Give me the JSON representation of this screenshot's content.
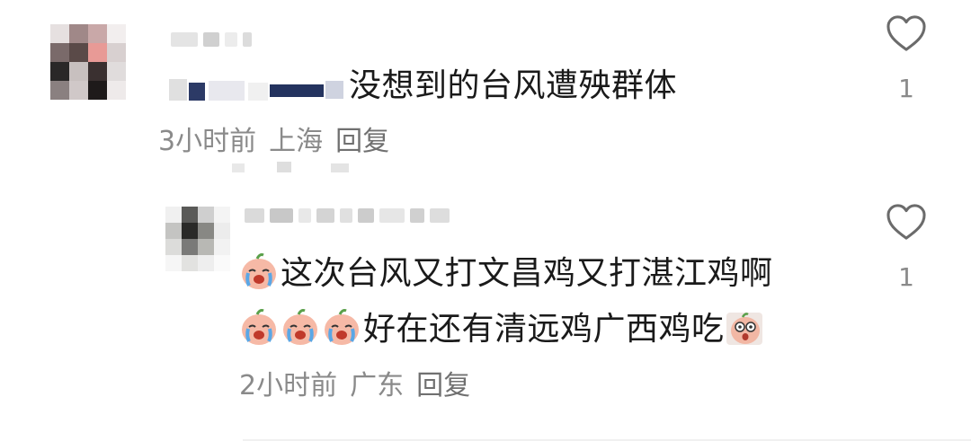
{
  "comments": [
    {
      "text": "没想到的台风遭殃群体",
      "time": "3小时前",
      "location": "上海",
      "reply_label": "回复",
      "likes": "1"
    }
  ],
  "replies": [
    {
      "line1": "这次台风又打文昌鸡又打湛江鸡啊",
      "line2": "好在还有清远鸡广西鸡吃",
      "time": "2小时前",
      "location": "广东",
      "reply_label": "回复",
      "likes": "1"
    }
  ],
  "icons": {
    "like": "heart-outline-icon",
    "emoji_crying": "crying-peach-emoji",
    "emoji_shocked": "shocked-peach-emoji"
  },
  "colors": {
    "text": "#1a1a1a",
    "meta": "#8a8a8a",
    "heart_stroke": "#6b6b6b",
    "emoji_skin": "#f6b9a6"
  }
}
